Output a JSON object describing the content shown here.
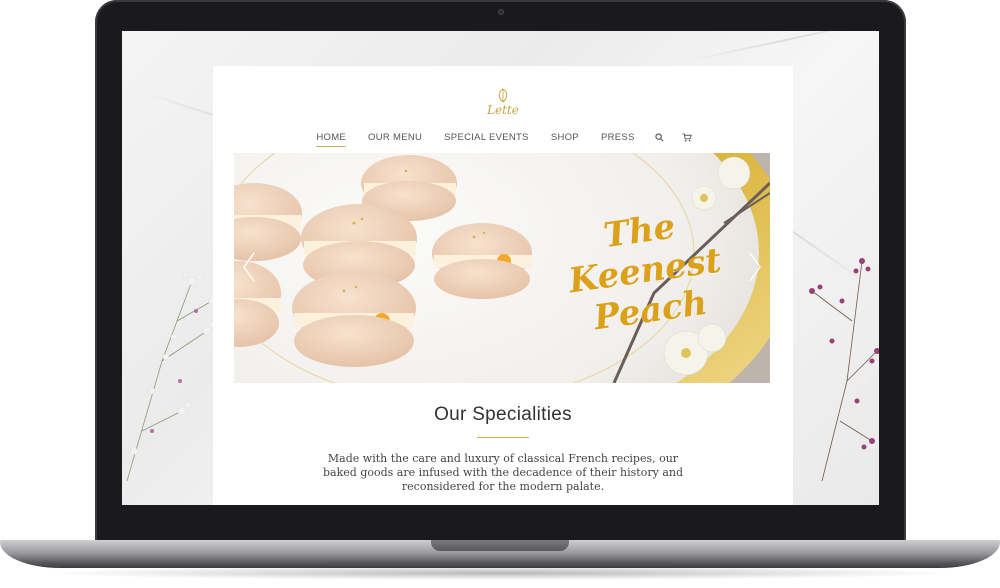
{
  "site": {
    "logo_text": "Lette"
  },
  "nav": {
    "items": [
      {
        "label": "HOME",
        "active": true
      },
      {
        "label": "OUR MENU",
        "active": false
      },
      {
        "label": "SPECIAL EVENTS",
        "active": false
      },
      {
        "label": "SHOP",
        "active": false
      },
      {
        "label": "PRESS",
        "active": false
      }
    ],
    "icons": [
      "search-icon",
      "cart-icon"
    ]
  },
  "hero": {
    "title_lines": [
      "The",
      "Keenest",
      "Peach"
    ],
    "prev_icon": "chevron-left-icon",
    "next_icon": "chevron-right-icon"
  },
  "specialities": {
    "title": "Our Specialities",
    "body": "Made with the care and luxury of classical French recipes, our baked goods are infused with the decadence of their history and reconsidered for the modern palate."
  },
  "colors": {
    "accent_gold": "#d4b061",
    "hero_title_gold": "#dba11a",
    "laptop_frame": "#1a1a1c",
    "text_dark": "#333333"
  }
}
